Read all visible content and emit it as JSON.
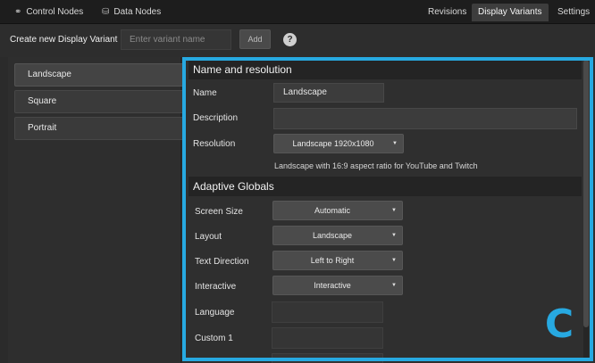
{
  "top_tabs": {
    "control_nodes": "Control Nodes",
    "data_nodes": "Data Nodes",
    "revisions": "Revisions",
    "display_variants": "Display Variants",
    "settings": "Settings"
  },
  "create": {
    "label": "Create new Display Variant",
    "input_placeholder": "Enter variant name",
    "input_value": "",
    "add_label": "Add",
    "help_glyph": "?"
  },
  "variants": [
    "Landscape",
    "Square",
    "Portrait"
  ],
  "selected_variant": "Landscape",
  "name_resolution": {
    "title": "Name and resolution",
    "name_label": "Name",
    "name_value": "Landscape",
    "description_label": "Description",
    "description_value": "",
    "resolution_label": "Resolution",
    "resolution_value": "Landscape 1920x1080",
    "resolution_hint": "Landscape with 16:9 aspect ratio for YouTube and Twitch"
  },
  "adaptive": {
    "title": "Adaptive Globals",
    "screen_size_label": "Screen Size",
    "screen_size_value": "Automatic",
    "layout_label": "Layout",
    "layout_value": "Landscape",
    "text_direction_label": "Text Direction",
    "text_direction_value": "Left to Right",
    "interactive_label": "Interactive",
    "interactive_value": "Interactive",
    "language_label": "Language",
    "language_value": "",
    "custom1_label": "Custom 1",
    "custom1_value": ""
  },
  "marker_letter": "C",
  "colors": {
    "highlight": "#27a9e1",
    "background": "#2b2b2b",
    "topbar": "#1d1d1d"
  },
  "icons": {
    "control_nodes": "link-icon",
    "data_nodes": "database-icon",
    "help": "help-icon",
    "caret": "caret-down-icon"
  }
}
